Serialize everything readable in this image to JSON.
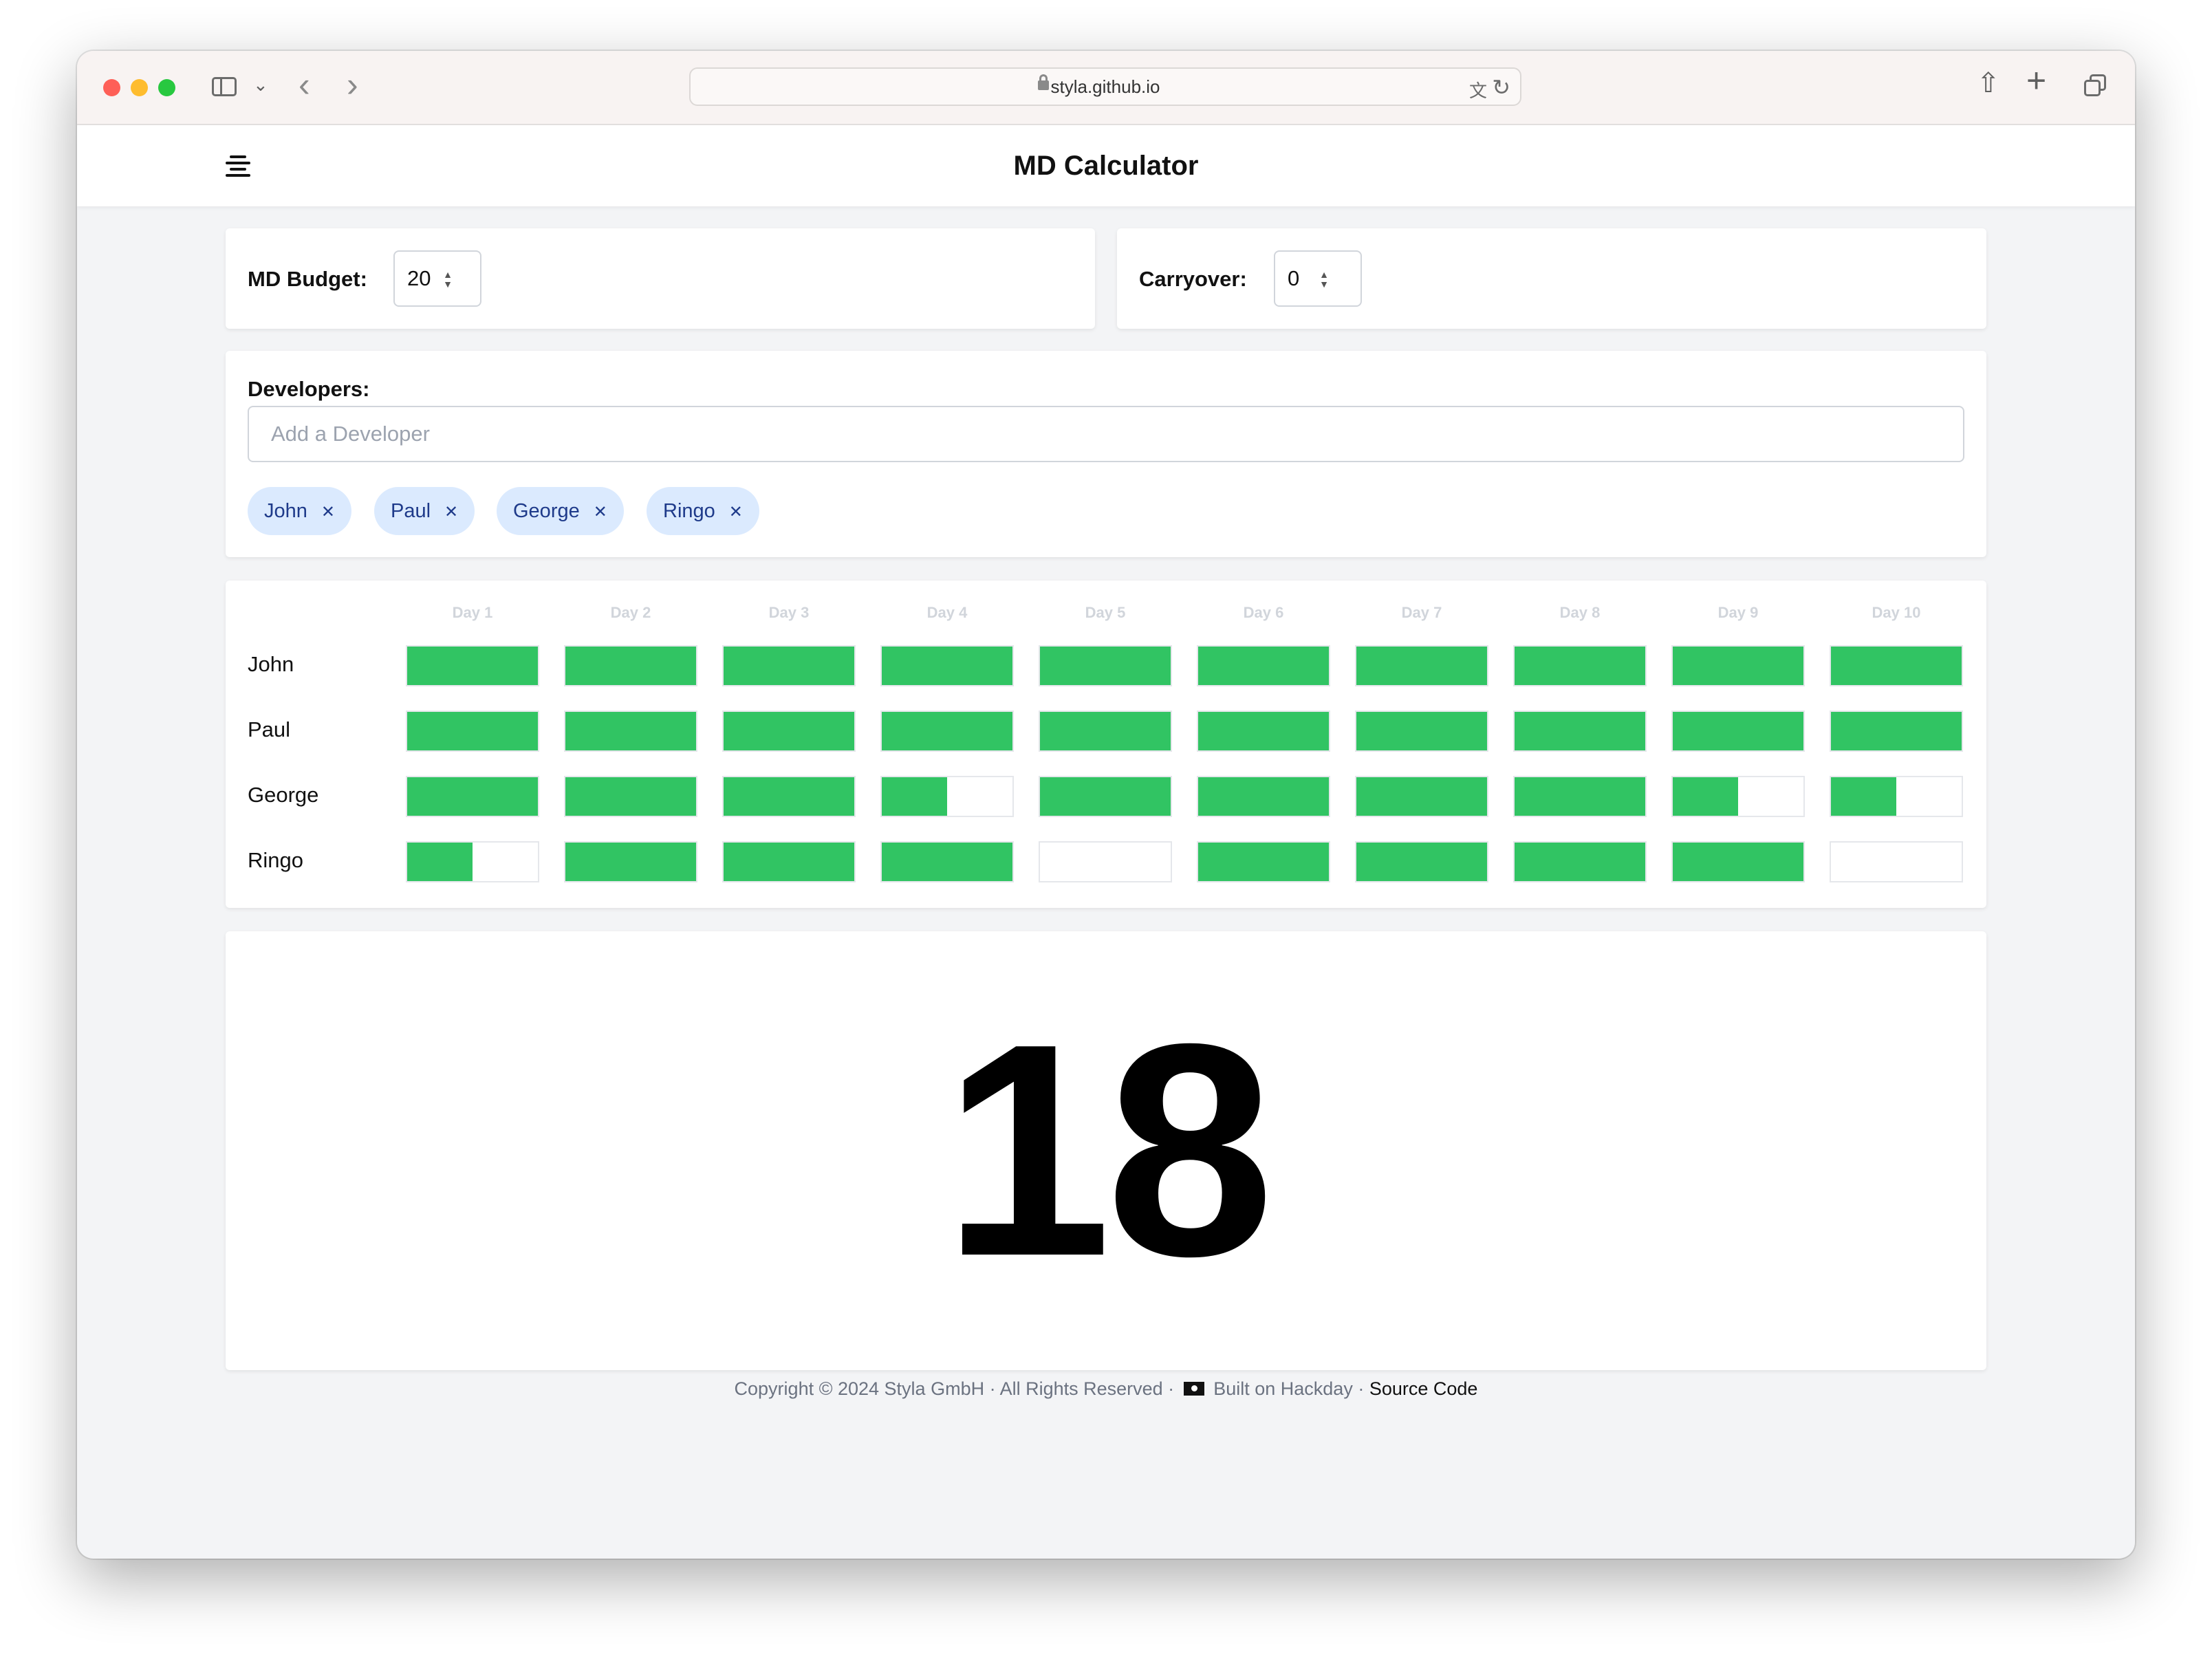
{
  "browser": {
    "url": "styla.github.io"
  },
  "app": {
    "title": "MD Calculator"
  },
  "budget": {
    "label": "MD Budget:",
    "value": "20"
  },
  "carryover": {
    "label": "Carryover:",
    "value": "0"
  },
  "developers": {
    "label": "Developers:",
    "placeholder": "Add a Developer",
    "chips": [
      "John",
      "Paul",
      "George",
      "Ringo"
    ]
  },
  "schedule": {
    "days": [
      "Day 1",
      "Day 2",
      "Day 3",
      "Day 4",
      "Day 5",
      "Day 6",
      "Day 7",
      "Day 8",
      "Day 9",
      "Day 10"
    ],
    "rows": [
      {
        "name": "John",
        "availability": [
          1,
          1,
          1,
          1,
          1,
          1,
          1,
          1,
          1,
          1
        ]
      },
      {
        "name": "Paul",
        "availability": [
          1,
          1,
          1,
          1,
          1,
          1,
          1,
          1,
          1,
          1
        ]
      },
      {
        "name": "George",
        "availability": [
          1,
          1,
          1,
          0.5,
          1,
          1,
          1,
          1,
          0.5,
          0.5
        ]
      },
      {
        "name": "Ringo",
        "availability": [
          0.5,
          1,
          1,
          1,
          0,
          1,
          1,
          1,
          1,
          0
        ]
      }
    ]
  },
  "result": {
    "value": "18"
  },
  "footer": {
    "copyright": "Copyright © 2024 Styla GmbH · All Rights Reserved ·",
    "built": "Built on Hackday ·",
    "source": "Source Code"
  },
  "colors": {
    "fill": "#31c463",
    "chip_bg": "#dbeafe",
    "chip_text": "#1e3a8a"
  },
  "icons": [
    "sidebar-icon",
    "chevron-down-icon",
    "back-arrow-icon",
    "forward-arrow-icon",
    "lock-icon",
    "translate-icon",
    "reload-icon",
    "share-icon",
    "plus-icon",
    "tabs-icon",
    "menu-icon",
    "close-icon",
    "pirate-flag-icon"
  ]
}
